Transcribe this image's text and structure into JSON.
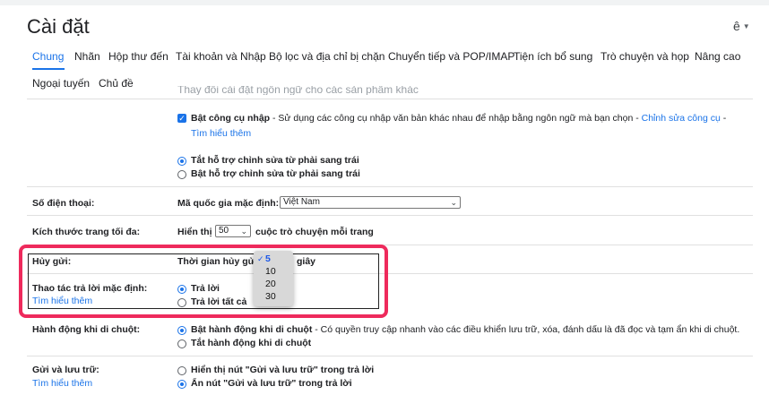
{
  "header": {
    "title": "Cài đặt",
    "language": "ê"
  },
  "tabs": [
    {
      "label": "Chung",
      "active": true
    },
    {
      "label": "Nhãn"
    },
    {
      "label": "Hộp thư đến"
    },
    {
      "label": "Tài khoản và Nhập"
    },
    {
      "label": "Bộ lọc và địa chỉ bị chặn"
    },
    {
      "label": "Chuyển tiếp và POP/IMAP"
    },
    {
      "label": "Tiện ích bổ sung"
    },
    {
      "label": "Trò chuyện và họp"
    },
    {
      "label": "Nâng cao"
    },
    {
      "label": "Ngoại tuyến"
    },
    {
      "label": "Chủ đề"
    }
  ],
  "input_tools": {
    "checkbox_label": "Bật công cụ nhập",
    "description": " - Sử dụng các công cụ nhập văn bản khác nhau để nhập bằng ngôn ngữ mà bạn chọn - ",
    "edit_link": "Chỉnh sửa công cụ",
    "learn_more": "Tìm hiểu thêm",
    "rtl_off": "Tắt hỗ trợ chỉnh sửa từ phải sang trái",
    "rtl_on": "Bật hỗ trợ chỉnh sửa từ phải sang trái"
  },
  "phone": {
    "label": "Số điện thoại:",
    "country_label": "Mã quốc gia mặc định:",
    "country_value": "Việt Nam"
  },
  "page_size": {
    "label": "Kích thước trang tối đa:",
    "show_label": "Hiển thị",
    "value": "50",
    "suffix": "cuộc trò chuyện mỗi trang"
  },
  "undo_send": {
    "label": "Hủy gửi:",
    "period_label": "Thời gian hủy gửi",
    "suffix": "giây",
    "options": [
      "5",
      "10",
      "20",
      "30"
    ],
    "selected": "5"
  },
  "reply_default": {
    "label": "Thao tác trả lời mặc định:",
    "learn_more": "Tìm hiểu thêm",
    "reply": "Trả lời",
    "reply_all": "Trả lời tất cả"
  },
  "hover_actions": {
    "label": "Hành động khi di chuột:",
    "on_label": "Bật hành động khi di chuột",
    "on_desc": " - Có quyền truy cập nhanh vào các điều khiển lưu trữ, xóa, đánh dấu là đã đọc và tạm ẩn khi di chuột.",
    "off_label": "Tắt hành động khi di chuột"
  },
  "send_archive": {
    "label": "Gửi và lưu trữ:",
    "learn_more": "Tìm hiểu thêm",
    "show": "Hiển thị nút \"Gửi và lưu trữ\" trong trả lời",
    "hide": "Ẩn nút \"Gửi và lưu trữ\" trong trả lời"
  },
  "colors": {
    "accent": "#1a73e8",
    "highlight": "#ee2a5c"
  }
}
